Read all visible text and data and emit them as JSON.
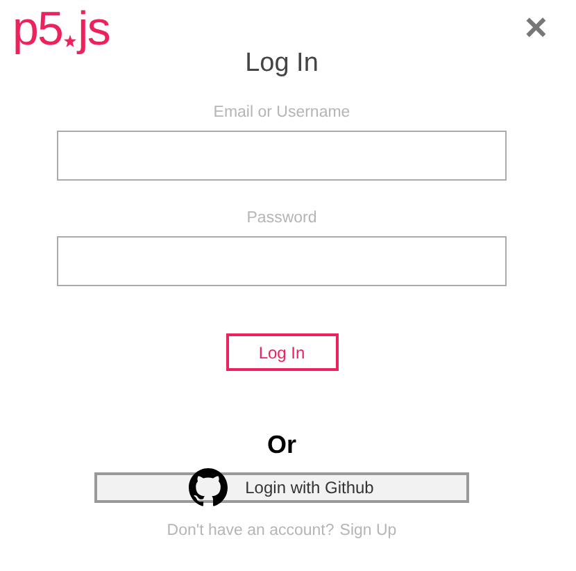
{
  "logo": {
    "left": "p5",
    "right": "js"
  },
  "close": "×",
  "title": "Log In",
  "fields": [
    {
      "label": "Email or Username"
    },
    {
      "label": "Password"
    }
  ],
  "submit": "Log In",
  "divider": "Or",
  "github_button": "Login with Github",
  "footer": {
    "text": "Don't have an account?",
    "link": "Sign Up"
  }
}
